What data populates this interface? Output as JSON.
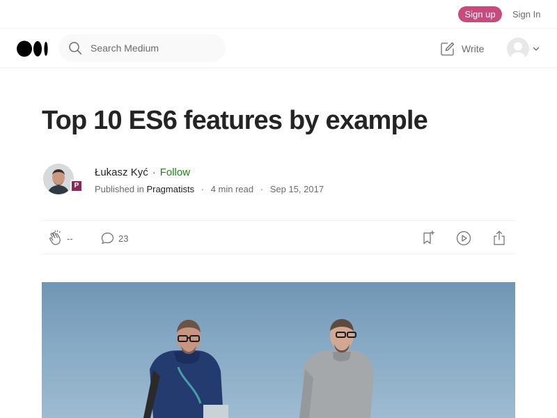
{
  "header": {
    "signup_label": "Sign up",
    "signin_label": "Sign In"
  },
  "nav": {
    "logo": "medium-logo",
    "search_placeholder": "Search Medium",
    "write_label": "Write"
  },
  "article": {
    "title": "Top 10 ES6 features by example",
    "author_name": "Łukasz Kyć",
    "separator": "·",
    "follow_label": "Follow",
    "published_prefix": "Published in",
    "publication": "Pragmatists",
    "read_time": "4 min read",
    "date": "Sep 15, 2017",
    "publication_badge": "P"
  },
  "actions": {
    "clap_count": "--",
    "response_count": "23"
  },
  "colors": {
    "accent_green": "#1a8917",
    "signup_pink": "#c94a7c",
    "text_dark": "#242424",
    "text_muted": "#6b6b6b",
    "sky": "#86a9c4"
  }
}
